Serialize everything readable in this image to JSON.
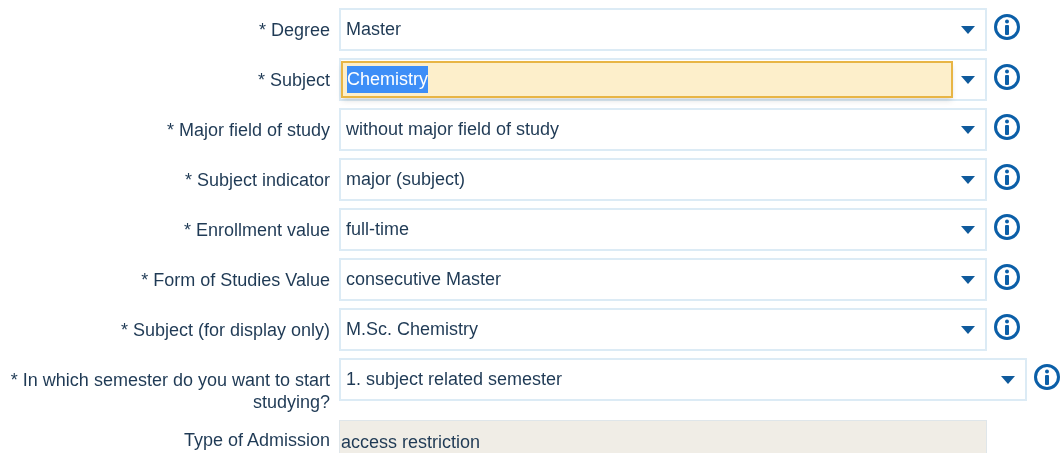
{
  "fields": [
    {
      "kind": "select",
      "label": "* Degree",
      "value": "Master",
      "focused": false
    },
    {
      "kind": "select",
      "label": "* Subject",
      "value": "Chemistry",
      "focused": true
    },
    {
      "kind": "select",
      "label": "* Major field of study",
      "value": "without major field of study",
      "focused": false
    },
    {
      "kind": "select",
      "label": "* Subject indicator",
      "value": "major (subject)",
      "focused": false
    },
    {
      "kind": "select",
      "label": "* Enrollment value",
      "value": "full-time",
      "focused": false
    },
    {
      "kind": "select",
      "label": "* Form of Studies Value",
      "value": "consecutive Master",
      "focused": false
    },
    {
      "kind": "select",
      "label": "* Subject (for display only)",
      "value": "M.Sc. Chemistry",
      "focused": false
    },
    {
      "kind": "wide_select",
      "label": "* In which semester do you want to start studying?",
      "value": "1. subject related semester",
      "focused": false
    },
    {
      "kind": "readonly",
      "label": "Type of Admission",
      "value": "access restriction"
    }
  ]
}
